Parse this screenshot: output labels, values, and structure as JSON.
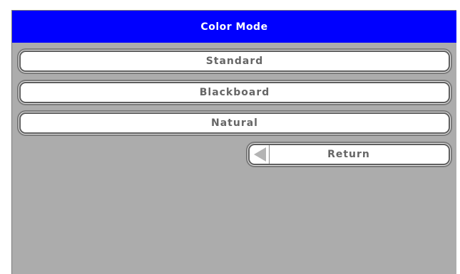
{
  "menu": {
    "title": "Color Mode",
    "options": [
      {
        "label": "Standard"
      },
      {
        "label": "Blackboard"
      },
      {
        "label": "Natural"
      }
    ],
    "return_label": "Return"
  },
  "icons": {
    "return": "left-arrow-icon"
  },
  "colors": {
    "title_bar": "#0000ff",
    "panel_background": "#acacac",
    "button_background": "#ffffff",
    "button_text": "#666666"
  }
}
